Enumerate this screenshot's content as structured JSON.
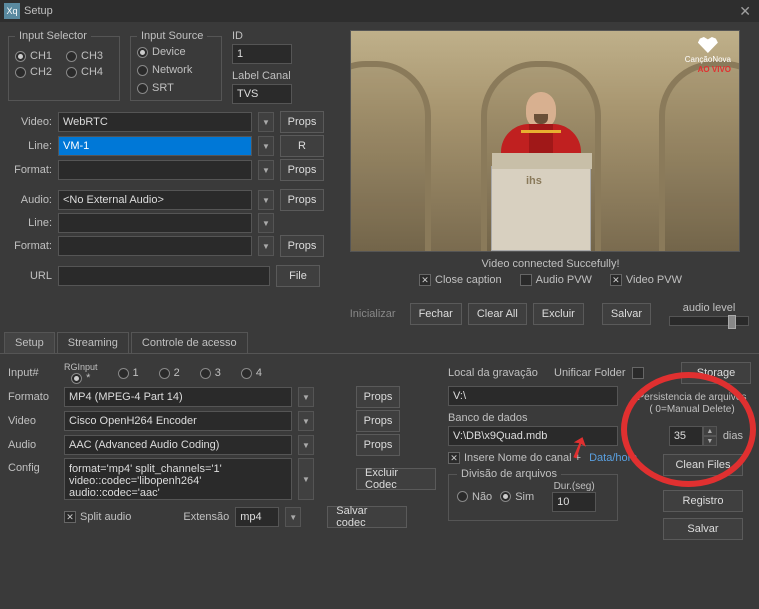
{
  "window": {
    "title": "Setup",
    "app_badge": "Xq"
  },
  "input_selector": {
    "legend": "Input Selector",
    "ch1": "CH1",
    "ch2": "CH2",
    "ch3": "CH3",
    "ch4": "CH4"
  },
  "input_source": {
    "legend": "Input Source",
    "device": "Device",
    "network": "Network",
    "srt": "SRT"
  },
  "id_block": {
    "id_label": "ID",
    "id_value": "1",
    "label_canal": "Label Canal",
    "label_canal_value": "TVS"
  },
  "rows": {
    "video_label": "Video:",
    "video_value": "WebRTC",
    "line_label": "Line:",
    "line_value": "VM-1",
    "format_label": "Format:",
    "format_value": "",
    "audio_label": "Audio:",
    "audio_value": "<No External Audio>",
    "line2_label": "Line:",
    "line2_value": "",
    "format2_label": "Format:",
    "format2_value": "",
    "url_label": "URL",
    "url_value": ""
  },
  "btns": {
    "props": "Props",
    "r": "R",
    "file": "File"
  },
  "preview": {
    "status": "Video connected Succefully!",
    "close_caption": "Close caption",
    "audio_pvw": "Audio PVW",
    "video_pvw": "Video PVW",
    "logo_top": "CançãoNova",
    "logo_sub": "AO VIVO",
    "ihs": "ihs"
  },
  "actions": {
    "inicializar": "Inicializar",
    "fechar": "Fechar",
    "clear_all": "Clear All",
    "excluir": "Excluir",
    "salvar": "Salvar",
    "audio_level": "audio level"
  },
  "tabs": {
    "setup": "Setup",
    "streaming": "Streaming",
    "controle": "Controle de acesso"
  },
  "lower_left": {
    "input_num": "Input#",
    "rginput": "RGInput",
    "r0": "*",
    "r1": "1",
    "r2": "2",
    "r3": "3",
    "r4": "4",
    "formato_label": "Formato",
    "formato_value": "MP4 (MPEG-4 Part 14)",
    "video_label": "Video",
    "video_value": "Cisco OpenH264 Encoder",
    "audio_label": "Audio",
    "audio_value": "AAC (Advanced Audio Coding)",
    "config_label": "Config",
    "config_value": "format='mp4' split_channels='1' video::codec='libopenh264' audio::codec='aac'",
    "excluir_codec": "Excluir Codec",
    "split_audio": "Split audio",
    "extensao_label": "Extensão",
    "extensao_value": "mp4",
    "salvar_codec": "Salvar codec"
  },
  "lower_right": {
    "local_label": "Local da gravação",
    "unificar": "Unificar Folder",
    "storage": "Storage",
    "local_value": "V:\\",
    "banco_label": "Banco de dados",
    "banco_value": "V:\\DB\\x9Quad.mdb",
    "insere": "Insere Nome do canal +",
    "data_hora": "Data/hora",
    "persist_label": "Persistencia de arquivos ( 0=Manual Delete)",
    "persist_value": "35",
    "dias": "dias",
    "clean": "Clean  Files",
    "divisao": "Divisão de arquivos",
    "nao": "Não",
    "sim": "Sim",
    "dur_label": "Dur.(seg)",
    "dur_value": "10",
    "registro": "Registro",
    "salvar": "Salvar"
  }
}
